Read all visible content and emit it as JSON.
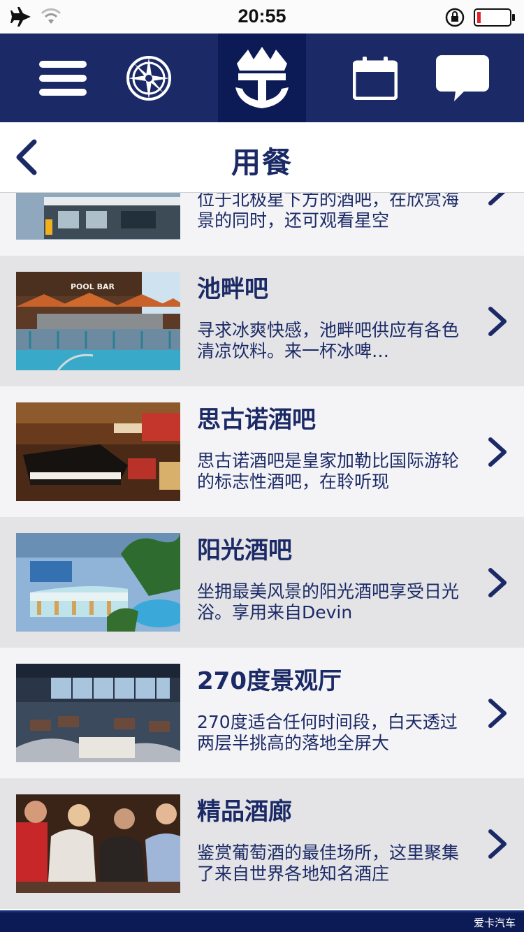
{
  "status_bar": {
    "time": "20:55",
    "icons": [
      "airplane-icon",
      "wifi-icon",
      "rotation-lock-icon",
      "battery-icon"
    ]
  },
  "nav": {
    "items": [
      "menu-icon",
      "compass-icon",
      "royal-caribbean-crown-anchor-logo",
      "calendar-icon",
      "chat-icon"
    ]
  },
  "header": {
    "title": "用餐",
    "back_icon": "chevron-left-icon"
  },
  "list": {
    "items": [
      {
        "title": "",
        "description": "位于北极星下方的酒吧，在欣赏海景的同时，还可观看星空",
        "image": "deck-bar-photo"
      },
      {
        "title": "池畔吧",
        "description": "寻求冰爽快感，池畔吧供应有各色清凉饮料。来一杯冰啤…",
        "image": "pool-bar-photo",
        "image_text": "POOL BAR"
      },
      {
        "title": "思古诺酒吧",
        "description": "思古诺酒吧是皇家加勒比国际游轮的标志性酒吧，在聆听现",
        "image": "piano-bar-photo"
      },
      {
        "title": "阳光酒吧",
        "description": "坐拥最美风景的阳光酒吧享受日光浴。享用来自Devin",
        "image": "sunshine-bar-photo"
      },
      {
        "title": "270度景观厅",
        "description": "270度适合任何时间段，白天透过两层半挑高的落地全屏大",
        "image": "lounge-270-photo"
      },
      {
        "title": "精品酒廊",
        "description": "鉴赏葡萄酒的最佳场所，这里聚集了来自世界各地知名酒庄",
        "image": "wine-bar-photo"
      }
    ]
  },
  "watermark": "爱卡汽车",
  "colors": {
    "brand_navy": "#1b2a66",
    "nav_center": "#0c1a55",
    "row_light": "#f4f4f6",
    "row_dark": "#e4e4e6"
  }
}
